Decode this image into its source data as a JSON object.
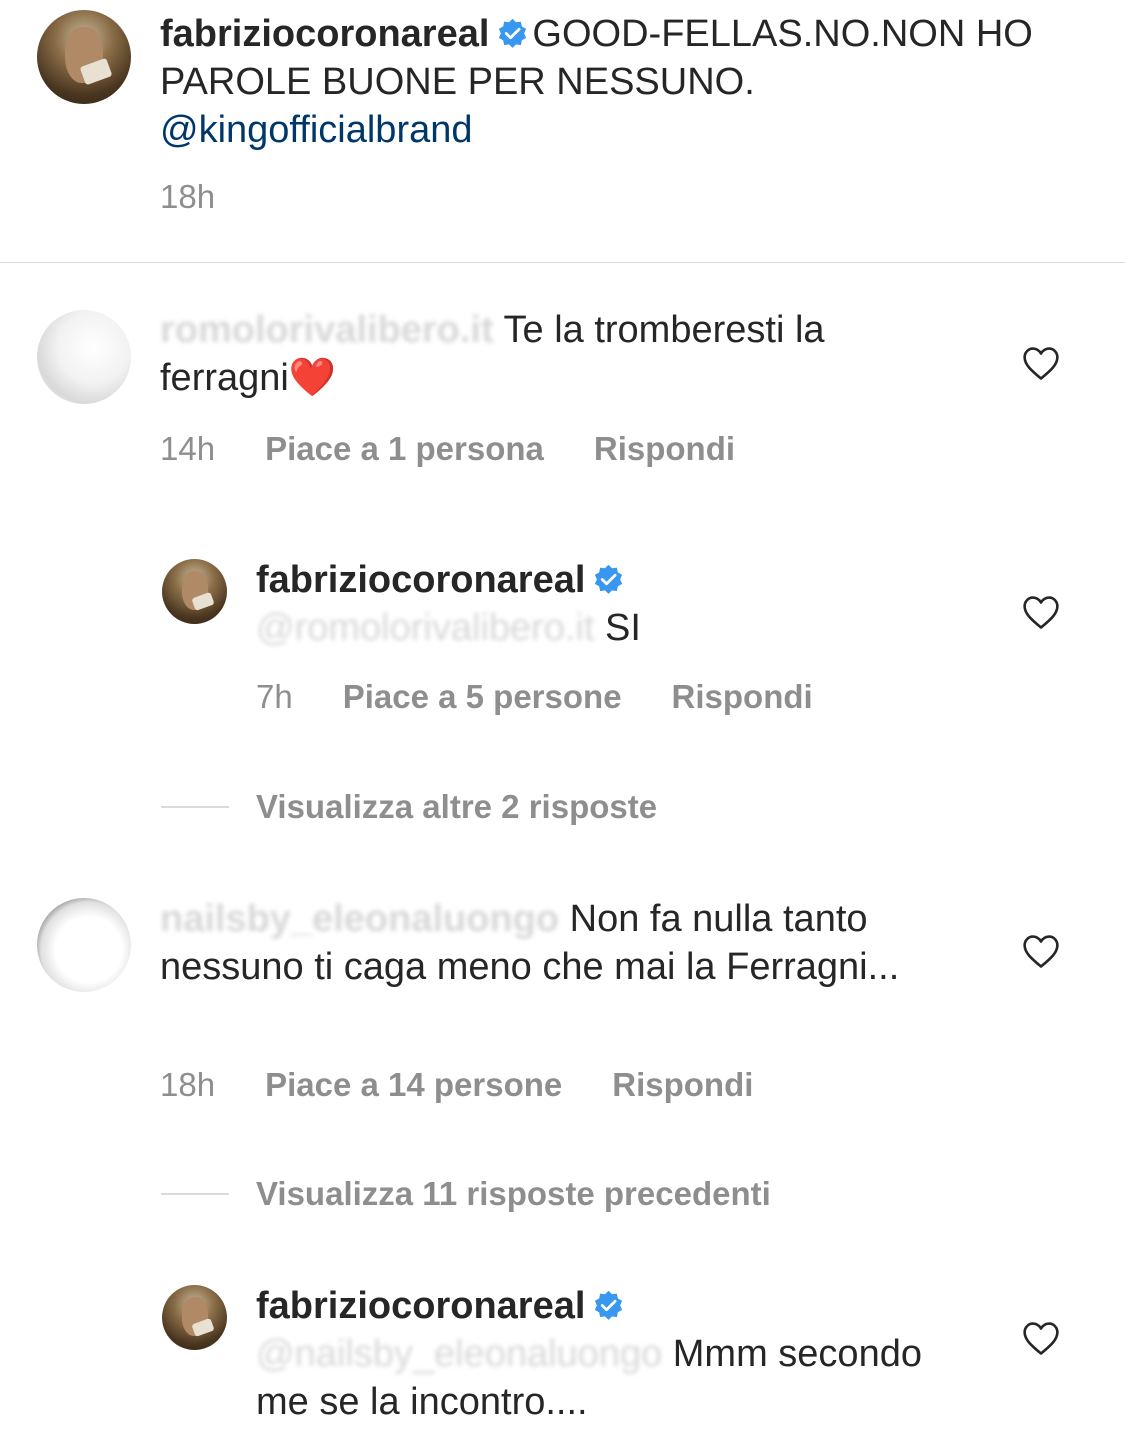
{
  "post_caption": {
    "username": "fabriziocoronareal",
    "text": "GOOD-FELLAS.NO.NON HO PAROLE BUONE PER NESSUNO.",
    "mention": "@kingofficialbrand",
    "time": "18h"
  },
  "comments": [
    {
      "username_blurred": "romolorivalibero.it",
      "text": "Te la tromberesti la ferragni",
      "emoji": "❤️",
      "time": "14h",
      "likes": "Piace a 1 persona",
      "reply_label": "Rispondi"
    },
    {
      "username": "fabriziocoronareal",
      "mention_blurred": "@romolorivalibero.it",
      "text": "SI",
      "time": "7h",
      "likes": "Piace a 5 persone",
      "reply_label": "Rispondi"
    },
    {
      "view_more": "Visualizza altre 2 risposte"
    },
    {
      "username_blurred": "nailsby_eleonaluongo",
      "text": "Non fa nulla tanto nessuno ti caga meno che mai la Ferragni...",
      "time": "18h",
      "likes": "Piace a 14 persone",
      "reply_label": "Rispondi"
    },
    {
      "view_more": "Visualizza 11 risposte precedenti"
    },
    {
      "username": "fabriziocoronareal",
      "mention_blurred": "@nailsby_eleonaluongo",
      "text": "Mmm secondo me se la incontro...."
    }
  ],
  "icons": {
    "verified": "verified-badge-icon",
    "like": "heart-outline-icon"
  },
  "colors": {
    "text": "#262626",
    "meta": "#8e8e8e",
    "link": "#00376b",
    "verified": "#3897f0",
    "heart_emoji": "#e0245e"
  }
}
